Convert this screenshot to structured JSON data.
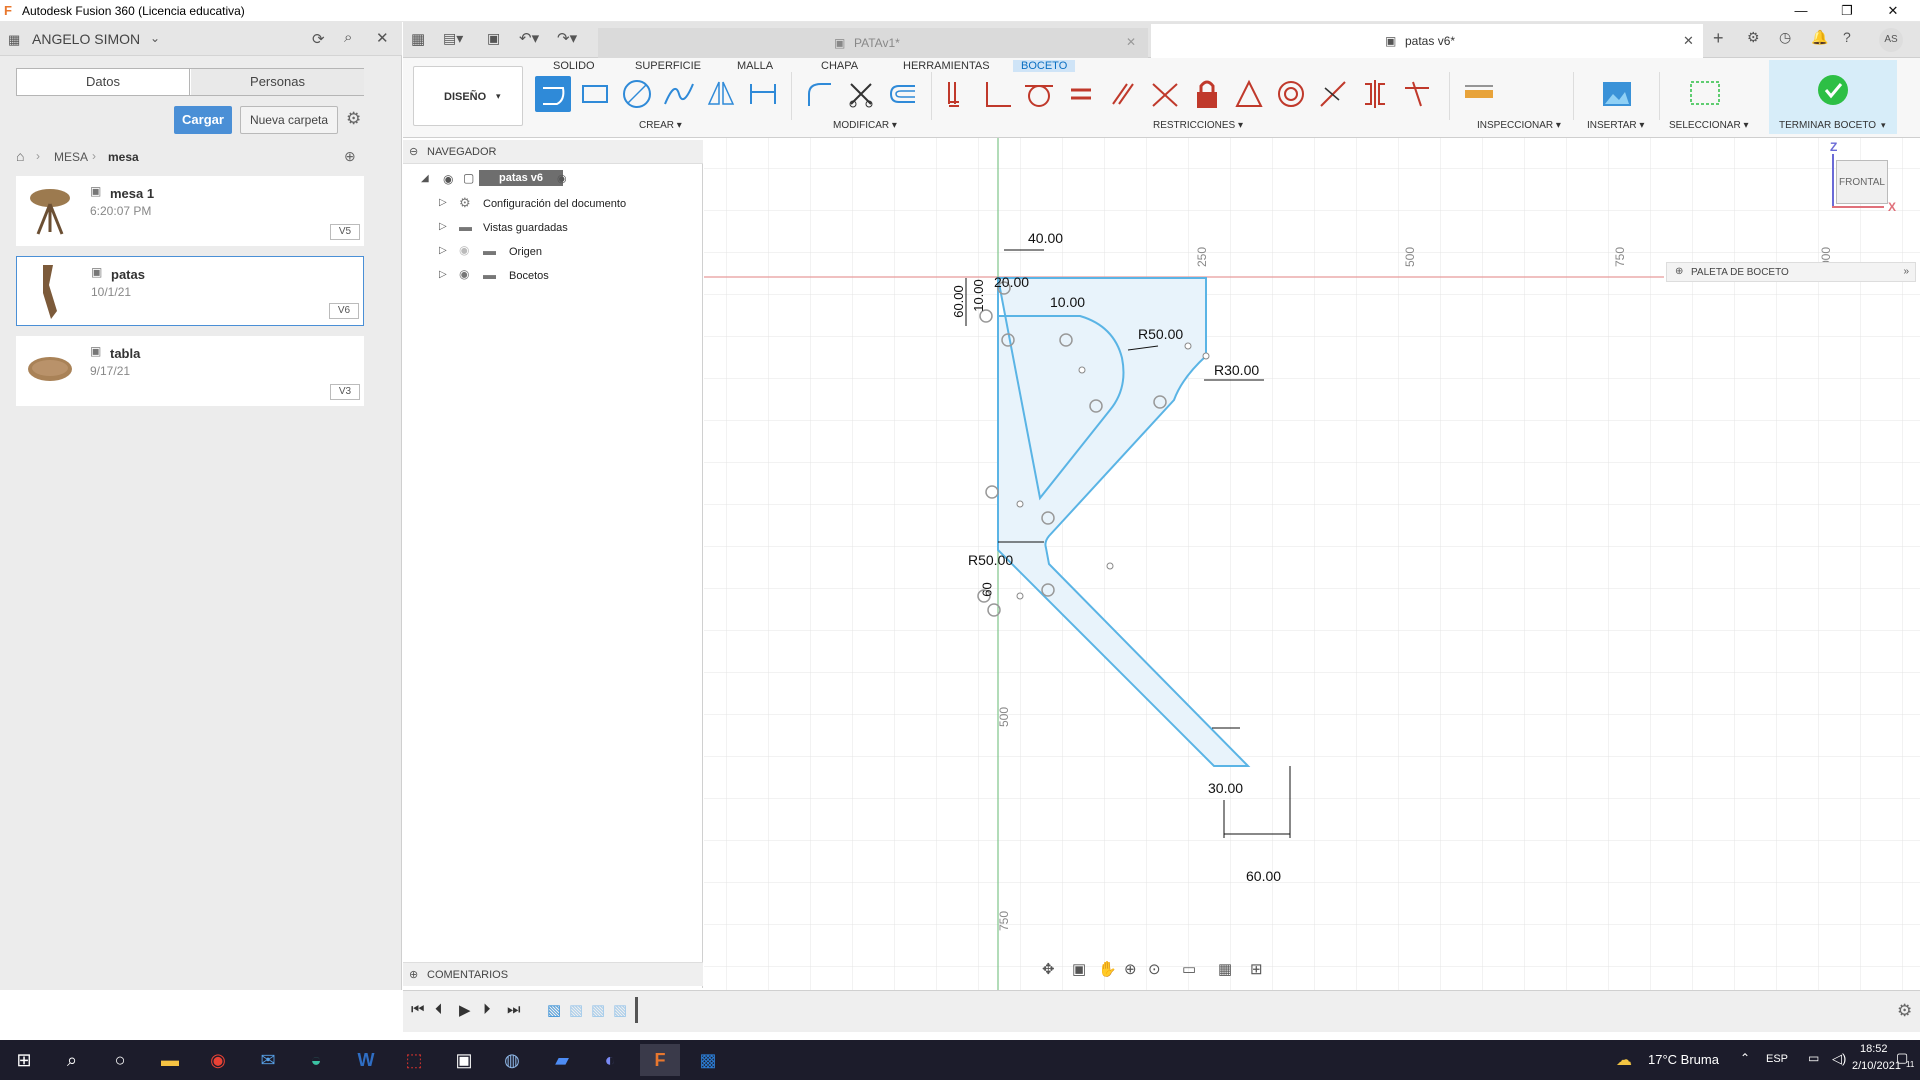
{
  "window": {
    "title": "Autodesk Fusion 360 (Licencia educativa)"
  },
  "user": {
    "name": "ANGELO SIMON"
  },
  "left_tabs": [
    "Datos",
    "Personas"
  ],
  "buttons": {
    "load": "Cargar",
    "new_folder": "Nueva carpeta"
  },
  "breadcrumb": [
    "MESA",
    "mesa"
  ],
  "files": [
    {
      "name": "mesa 1",
      "date": "6:20:07 PM",
      "version": "V5"
    },
    {
      "name": "patas",
      "date": "10/1/21",
      "version": "V6"
    },
    {
      "name": "tabla",
      "date": "9/17/21",
      "version": "V3"
    }
  ],
  "doc_tabs": [
    {
      "label": "PATAv1*"
    },
    {
      "label": "patas v6*"
    }
  ],
  "ribbon_tabs": [
    "SOLIDO",
    "SUPERFICIE",
    "MALLA",
    "CHAPA",
    "HERRAMIENTAS",
    "BOCETO"
  ],
  "ribbon_groups": {
    "workspace": "DISEÑO",
    "create": "CREAR",
    "modify": "MODIFICAR",
    "constraints": "RESTRICCIONES",
    "inspect": "INSPECCIONAR",
    "insert": "INSERTAR",
    "select": "SELECCIONAR",
    "finish": "TERMINAR BOCETO"
  },
  "navigator": {
    "title": "NAVEGADOR",
    "root": "patas v6",
    "items": [
      "Configuración del documento",
      "Vistas guardadas",
      "Origen",
      "Bocetos"
    ]
  },
  "comments": "COMENTARIOS",
  "sketch_palette": "PALETA DE BOCETO",
  "viewcube": {
    "face": "FRONTAL",
    "z": "Z",
    "x": "X"
  },
  "axis_ticks": {
    "t250": "250",
    "t500": "500",
    "t750": "750",
    "t1000": "000",
    "v500": "500",
    "v750": "750"
  },
  "dimensions": {
    "d40": "40.00",
    "d20": "20.00",
    "d10": "10.00",
    "d60v": "60.00",
    "d10v": "10.00",
    "r50": "R50.00",
    "r30": "R30.00",
    "r50b": "R50.00",
    "v60": "60",
    "d30": "30.00",
    "d60": "60.00"
  },
  "taskbar": {
    "weather": "17°C Bruma",
    "lang": "ESP",
    "time": "18:52",
    "date": "2/10/2021",
    "notif": "11"
  },
  "colors": {
    "accent": "#4a8fd6",
    "sketch_fill": "#e8f3fb",
    "sketch_line": "#5ab4e5",
    "finish_green": "#2dbf45"
  }
}
